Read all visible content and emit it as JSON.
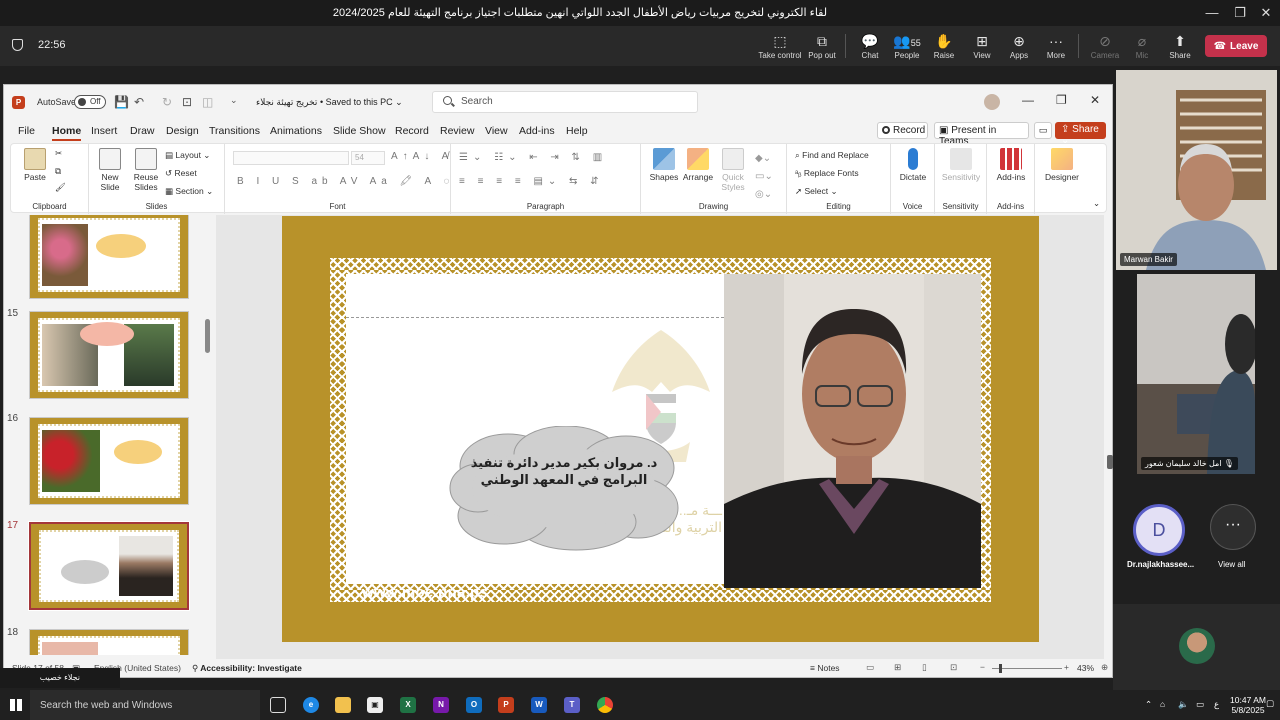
{
  "teams": {
    "meeting_title": "لقاء الكتروني لتخريج مربيات رياض الأطفال الجدد اللواتي انهين متطلبات اجتياز برنامج التهيئة للعام 2024/2025",
    "timer": "22:56",
    "controls": [
      {
        "label": "Take control",
        "icon": "take-control-icon"
      },
      {
        "label": "Pop out",
        "icon": "pop-out-icon"
      },
      {
        "label": "Chat",
        "icon": "chat-icon"
      },
      {
        "label": "People",
        "icon": "people-icon",
        "badge": "55"
      },
      {
        "label": "Raise",
        "icon": "raise-hand-icon"
      },
      {
        "label": "View",
        "icon": "view-icon"
      },
      {
        "label": "Apps",
        "icon": "apps-icon"
      },
      {
        "label": "More",
        "icon": "more-icon"
      },
      {
        "label": "Camera",
        "icon": "camera-off-icon"
      },
      {
        "label": "Mic",
        "icon": "mic-off-icon"
      },
      {
        "label": "Share",
        "icon": "share-icon"
      }
    ],
    "leave_label": "Leave",
    "accent": "#c4314b"
  },
  "ppt": {
    "autosave_label": "AutoSave",
    "autosave_state": "Off",
    "doc_title": "تخريج تهيئة نجلاء • Saved to this PC",
    "search_placeholder": "Search",
    "menu_tabs": [
      "File",
      "Home",
      "Insert",
      "Draw",
      "Design",
      "Transitions",
      "Animations",
      "Slide Show",
      "Record",
      "Review",
      "View",
      "Add-ins",
      "Help"
    ],
    "record_label": "Record",
    "present_label": "Present in Teams",
    "share_label": "Share",
    "ribbon": {
      "paste": "Paste",
      "clipboard": "Clipboard",
      "new_slide": "New Slide",
      "reuse_slides": "Reuse Slides",
      "layout": "Layout",
      "reset": "Reset",
      "section": "Section",
      "slides": "Slides",
      "font_size": "54",
      "font": "Font",
      "paragraph": "Paragraph",
      "shapes": "Shapes",
      "arrange": "Arrange",
      "quick_styles": "Quick Styles",
      "drawing": "Drawing",
      "find_replace": "Find and Replace",
      "replace_fonts": "Replace Fonts",
      "select": "Select",
      "editing": "Editing",
      "dictate": "Dictate",
      "voice": "Voice",
      "sensitivity": "Sensitivity",
      "sensitivity_group": "Sensitivity",
      "addins": "Add-ins",
      "addins_group": "Add-ins",
      "designer": "Designer"
    },
    "thumbnails": [
      {
        "num": "",
        "kind": "flowers"
      },
      {
        "num": "15",
        "kind": "two-women"
      },
      {
        "num": "16",
        "kind": "roses"
      },
      {
        "num": "17",
        "kind": "current",
        "selected": true
      },
      {
        "num": "18",
        "kind": "partial"
      }
    ],
    "slide": {
      "cloud_text": "د. مروان بكير مدير دائرة تنفيذ البرامج في المعهد الوطني",
      "watermark": "ـــة مـ... وزارة التربية والتعليم",
      "url": "www.moe.pna.ps",
      "gold": "#b8922a"
    },
    "status": {
      "slide_count": "Slide 17 of 58",
      "language": "English (United States)",
      "accessibility": "Accessibility: Investigate",
      "notes": "Notes",
      "zoom": "43%"
    }
  },
  "participants": {
    "tile1_name": "Marwan Bakir",
    "tile2_name": "امل خالد سليمان شعور",
    "avatar_letter": "D",
    "avatar_name": "Dr.najlakhassee...",
    "view_all": "View all",
    "caption_name": "نجلاء خصيب"
  },
  "taskbar": {
    "search_placeholder": "Search the web and Windows",
    "time": "10:47 AM",
    "date": "5/8/2025"
  }
}
